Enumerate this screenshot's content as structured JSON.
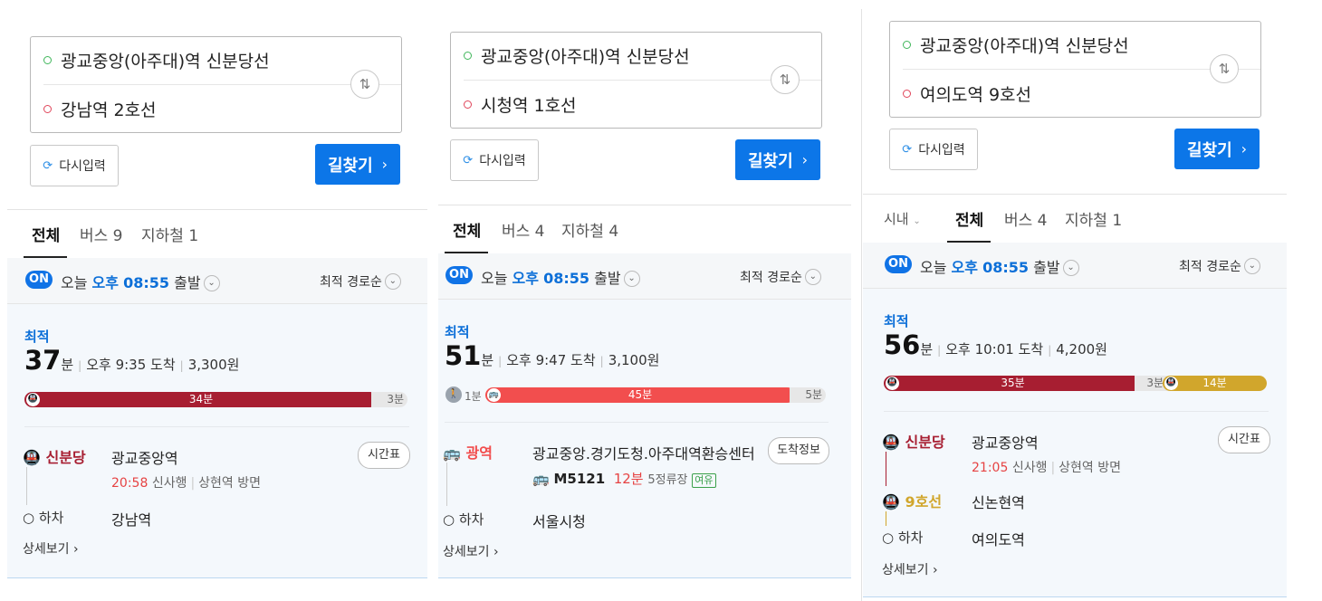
{
  "colors": {
    "accent": "#0c76e8",
    "shinbundang": "#a71e31",
    "line9": "#d1a62c",
    "gwangyeok": "#f24e4e",
    "walk": "#9aa3ad"
  },
  "common": {
    "reset_label": "다시입력",
    "search_button": "길찾기",
    "on_badge": "ON",
    "dep_today": "오늘",
    "dep_ampm": "오후",
    "dep_time": "08:55",
    "dep_suffix": "출발",
    "sort_label": "최적 경로순",
    "best_label": "최적",
    "min_unit": "분",
    "detail_link": "상세보기",
    "off_label": "하차"
  },
  "panels": [
    {
      "origin": "광교중앙(아주대)역 신분당선",
      "destination": "강남역 2호선",
      "tabs": [
        "전체",
        "버스 9",
        "지하철 1"
      ],
      "total_min": "37",
      "arrival": "오후 9:35 도착",
      "fare": "3,300원",
      "bar": {
        "ride": "34분",
        "ride_fraction": 0.9,
        "tail": "3분"
      },
      "line": "신분당",
      "board_stop": "광교중앙역",
      "next_time": "20:58",
      "direction": "신사행",
      "toward": "상현역 방면",
      "action": "시간표",
      "alight_stop": "강남역"
    },
    {
      "origin": "광교중앙(아주대)역 신분당선",
      "destination": "시청역 1호선",
      "tabs": [
        "전체",
        "버스 4",
        "지하철 4"
      ],
      "total_min": "51",
      "arrival": "오후 9:47 도착",
      "fare": "3,100원",
      "bar": {
        "walk": "1분",
        "ride": "45분",
        "ride_fraction": 0.82,
        "tail": "5분"
      },
      "line": "광역",
      "board_stop": "광교중앙.경기도청.아주대역환승센터",
      "bus_no": "M5121",
      "bus_wait": "12분",
      "bus_stops": "5정류장",
      "seat": "여유",
      "action": "도착정보",
      "alight_stop": "서울시청"
    },
    {
      "origin": "광교중앙(아주대)역 신분당선",
      "destination": "여의도역 9호선",
      "region": "시내",
      "tabs": [
        "전체",
        "버스 4",
        "지하철 1"
      ],
      "total_min": "56",
      "arrival": "오후 10:01 도착",
      "fare": "4,200원",
      "bar": {
        "seg1": "35분",
        "seg1_fraction": 0.63,
        "transfer": "3분",
        "seg2": "14분",
        "seg2_fraction": 0.26
      },
      "line": "신분당",
      "board_stop": "광교중앙역",
      "next_time": "21:05",
      "direction": "신사행",
      "toward": "상현역 방면",
      "action": "시간표",
      "line2": "9호선",
      "transfer_stop": "신논현역",
      "alight_stop": "여의도역"
    }
  ]
}
